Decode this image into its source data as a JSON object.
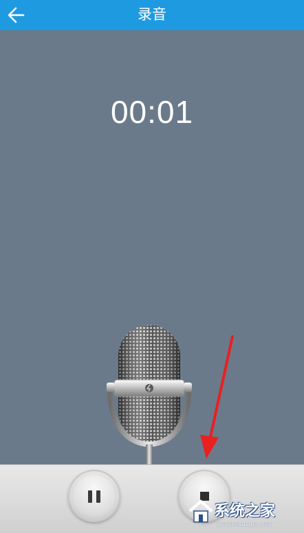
{
  "header": {
    "title": "录音",
    "back_icon": "arrow-left-icon"
  },
  "recorder": {
    "elapsed_time": "00:01",
    "mic_icon": "microphone-icon"
  },
  "controls": {
    "pause_icon": "pause-icon",
    "stop_icon": "stop-icon"
  },
  "annotation": {
    "arrow_color": "#e82020"
  },
  "watermark": {
    "brand": "系统之家",
    "url": "XITONGZHIJIA.NET"
  },
  "colors": {
    "appbar": "#1e9ae0",
    "background": "#6b7a8b",
    "control_bar": "#dcdcdc"
  }
}
